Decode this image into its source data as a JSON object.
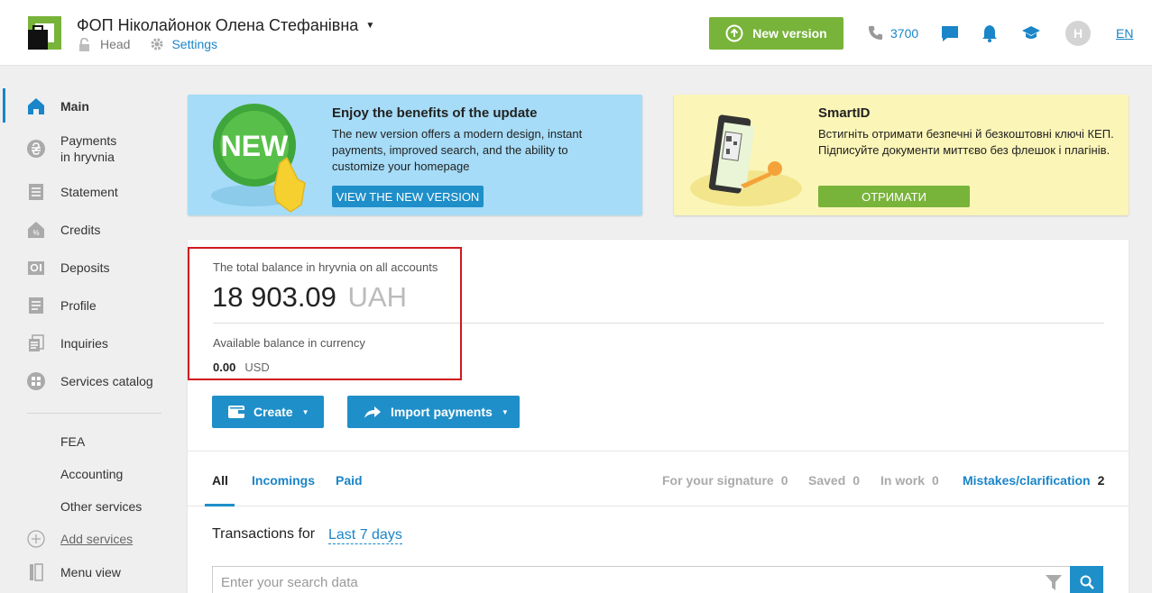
{
  "header": {
    "company_name": "ФОП Ніколайонок Олена Стефанівна",
    "branch": "Head",
    "settings_label": "Settings",
    "new_version_label": "New version",
    "phone": "3700",
    "avatar_initial": "H",
    "language": "EN",
    "icons": [
      "phone-icon",
      "chat-icon",
      "bell-icon",
      "graduation-cap-icon"
    ]
  },
  "sidebar": {
    "items": [
      {
        "label": "Main",
        "icon": "home-icon",
        "active": true
      },
      {
        "label": "Payments\nin hryvnia",
        "icon": "hryvnia-icon"
      },
      {
        "label": "Statement",
        "icon": "statement-icon"
      },
      {
        "label": "Credits",
        "icon": "credits-icon"
      },
      {
        "label": "Deposits",
        "icon": "deposits-icon"
      },
      {
        "label": "Profile",
        "icon": "profile-icon"
      },
      {
        "label": "Inquiries",
        "icon": "inquiries-icon"
      },
      {
        "label": "Services catalog",
        "icon": "services-icon"
      }
    ],
    "extra": [
      "FEA",
      "Accounting",
      "Other services"
    ],
    "add_services": "Add services",
    "menu_view": "Menu view"
  },
  "promo_update": {
    "badge": "NEW",
    "title": "Enjoy the benefits of the update",
    "text": "The new version offers a modern design, instant payments, improved search, and the ability to customize your homepage",
    "button": "VIEW THE NEW VERSION"
  },
  "promo_smartid": {
    "title": "SmartID",
    "text": "Встигніть отримати безпечні й безкоштовні ключі КЕП. Підписуйте документи миттєво без флешок і плагінів.",
    "button": "ОТРИМАТИ"
  },
  "balance": {
    "label": "The total balance in hryvnia on all accounts",
    "amount": "18 903.09",
    "currency": "UAH",
    "available_label": "Available balance in currency",
    "available_amount": "0.00",
    "available_currency": "USD"
  },
  "actions": {
    "create": "Create",
    "import": "Import payments"
  },
  "tabs": {
    "all": "All",
    "incomings": "Incomings",
    "paid": "Paid"
  },
  "stats": {
    "signature_label": "For your signature",
    "signature_count": "0",
    "saved_label": "Saved",
    "saved_count": "0",
    "inwork_label": "In work",
    "inwork_count": "0",
    "mistakes_label": "Mistakes/clarification",
    "mistakes_count": "2"
  },
  "transactions": {
    "label": "Transactions for",
    "period": "Last 7 days",
    "search_placeholder": "Enter your search data"
  },
  "colors": {
    "accent": "#1f8fc9",
    "green": "#78b33a",
    "highlight": "#d0181e"
  }
}
